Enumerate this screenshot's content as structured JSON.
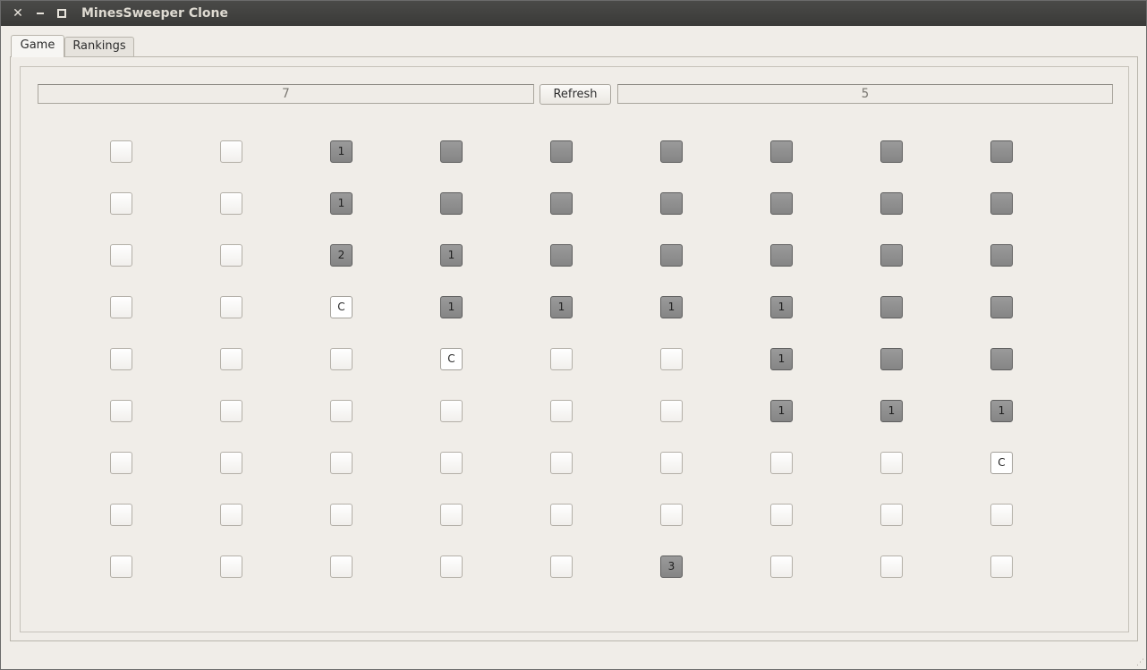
{
  "window": {
    "title": "MinesSweeper Clone",
    "close_glyph": "✕",
    "controls": [
      "close-icon",
      "minimize-icon",
      "maximize-icon"
    ]
  },
  "tabs": [
    {
      "label": "Game",
      "active": true
    },
    {
      "label": "Rankings",
      "active": false
    }
  ],
  "game": {
    "mines_display": "7",
    "refresh_label": "Refresh",
    "timer_display": "5",
    "board": [
      [
        {
          "s": "hidden",
          "t": ""
        },
        {
          "s": "hidden",
          "t": ""
        },
        {
          "s": "revealed",
          "t": "1"
        },
        {
          "s": "revealed",
          "t": ""
        },
        {
          "s": "revealed",
          "t": ""
        },
        {
          "s": "revealed",
          "t": ""
        },
        {
          "s": "revealed",
          "t": ""
        },
        {
          "s": "revealed",
          "t": ""
        },
        {
          "s": "revealed",
          "t": ""
        }
      ],
      [
        {
          "s": "hidden",
          "t": ""
        },
        {
          "s": "hidden",
          "t": ""
        },
        {
          "s": "revealed",
          "t": "1"
        },
        {
          "s": "revealed",
          "t": ""
        },
        {
          "s": "revealed",
          "t": ""
        },
        {
          "s": "revealed",
          "t": ""
        },
        {
          "s": "revealed",
          "t": ""
        },
        {
          "s": "revealed",
          "t": ""
        },
        {
          "s": "revealed",
          "t": ""
        }
      ],
      [
        {
          "s": "hidden",
          "t": ""
        },
        {
          "s": "hidden",
          "t": ""
        },
        {
          "s": "revealed",
          "t": "2"
        },
        {
          "s": "revealed",
          "t": "1"
        },
        {
          "s": "revealed",
          "t": ""
        },
        {
          "s": "revealed",
          "t": ""
        },
        {
          "s": "revealed",
          "t": ""
        },
        {
          "s": "revealed",
          "t": ""
        },
        {
          "s": "revealed",
          "t": ""
        }
      ],
      [
        {
          "s": "hidden",
          "t": ""
        },
        {
          "s": "hidden",
          "t": ""
        },
        {
          "s": "cleared",
          "t": "C"
        },
        {
          "s": "revealed",
          "t": "1"
        },
        {
          "s": "revealed",
          "t": "1"
        },
        {
          "s": "revealed",
          "t": "1"
        },
        {
          "s": "revealed",
          "t": "1"
        },
        {
          "s": "revealed",
          "t": ""
        },
        {
          "s": "revealed",
          "t": ""
        }
      ],
      [
        {
          "s": "hidden",
          "t": ""
        },
        {
          "s": "hidden",
          "t": ""
        },
        {
          "s": "hidden",
          "t": ""
        },
        {
          "s": "cleared",
          "t": "C"
        },
        {
          "s": "hidden",
          "t": ""
        },
        {
          "s": "hidden",
          "t": ""
        },
        {
          "s": "revealed",
          "t": "1"
        },
        {
          "s": "revealed",
          "t": ""
        },
        {
          "s": "revealed",
          "t": ""
        }
      ],
      [
        {
          "s": "hidden",
          "t": ""
        },
        {
          "s": "hidden",
          "t": ""
        },
        {
          "s": "hidden",
          "t": ""
        },
        {
          "s": "hidden",
          "t": ""
        },
        {
          "s": "hidden",
          "t": ""
        },
        {
          "s": "hidden",
          "t": ""
        },
        {
          "s": "revealed",
          "t": "1"
        },
        {
          "s": "revealed",
          "t": "1"
        },
        {
          "s": "revealed",
          "t": "1"
        }
      ],
      [
        {
          "s": "hidden",
          "t": ""
        },
        {
          "s": "hidden",
          "t": ""
        },
        {
          "s": "hidden",
          "t": ""
        },
        {
          "s": "hidden",
          "t": ""
        },
        {
          "s": "hidden",
          "t": ""
        },
        {
          "s": "hidden",
          "t": ""
        },
        {
          "s": "hidden",
          "t": ""
        },
        {
          "s": "hidden",
          "t": ""
        },
        {
          "s": "cleared",
          "t": "C"
        }
      ],
      [
        {
          "s": "hidden",
          "t": ""
        },
        {
          "s": "hidden",
          "t": ""
        },
        {
          "s": "hidden",
          "t": ""
        },
        {
          "s": "hidden",
          "t": ""
        },
        {
          "s": "hidden",
          "t": ""
        },
        {
          "s": "hidden",
          "t": ""
        },
        {
          "s": "hidden",
          "t": ""
        },
        {
          "s": "hidden",
          "t": ""
        },
        {
          "s": "hidden",
          "t": ""
        }
      ],
      [
        {
          "s": "hidden",
          "t": ""
        },
        {
          "s": "hidden",
          "t": ""
        },
        {
          "s": "hidden",
          "t": ""
        },
        {
          "s": "hidden",
          "t": ""
        },
        {
          "s": "hidden",
          "t": ""
        },
        {
          "s": "revealed",
          "t": "3"
        },
        {
          "s": "hidden",
          "t": ""
        },
        {
          "s": "hidden",
          "t": ""
        },
        {
          "s": "hidden",
          "t": ""
        }
      ]
    ]
  },
  "colors": {
    "titlebar": "#3c3b37",
    "window_bg": "#f0ede8",
    "revealed_cell": "#8c8c8c",
    "hidden_cell": "#f8f7f5"
  }
}
